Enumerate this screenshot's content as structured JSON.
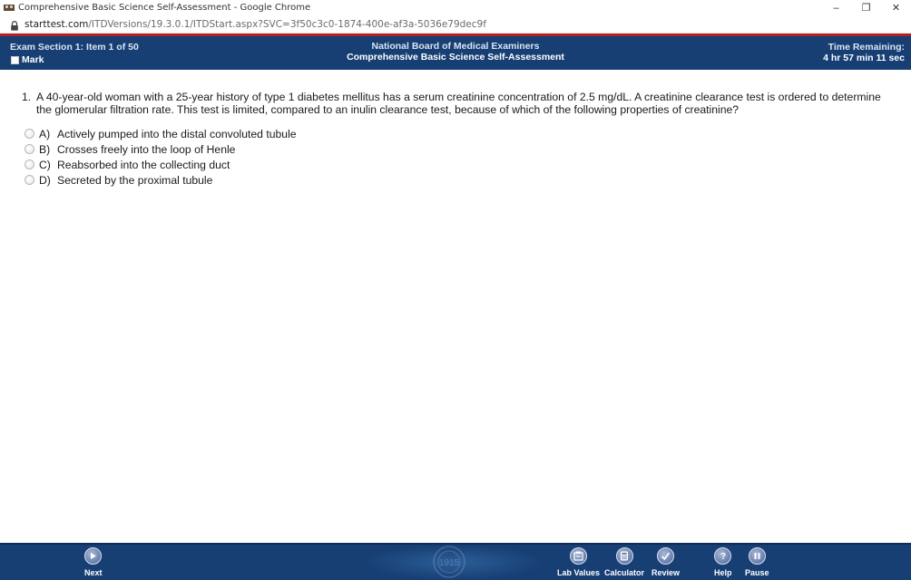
{
  "browser": {
    "window_title": "Comprehensive Basic Science Self-Assessment - Google Chrome",
    "url_host": "starttest.com",
    "url_path": "/ITDVersions/19.3.0.1/ITDStart.aspx?SVC=3f50c3c0-1874-400e-af3a-5036e79dec9f",
    "controls": {
      "minimize": "–",
      "restore": "❐",
      "close": "✕"
    }
  },
  "header": {
    "section_info": "Exam Section 1: Item 1 of 50",
    "mark_label": "Mark",
    "org": "National Board of Medical Examiners",
    "exam_title": "Comprehensive Basic Science Self-Assessment",
    "time_label": "Time Remaining:",
    "time_value": "4 hr 57 min 11 sec"
  },
  "question": {
    "number": "1.",
    "text": "A 40-year-old woman with a 25-year history of type 1 diabetes mellitus has a serum creatinine concentration of 2.5 mg/dL. A creatinine clearance test is ordered to determine the glomerular filtration rate. This test is limited, compared to an inulin clearance test, because of which of the following properties of creatinine?",
    "options": [
      {
        "letter": "A)",
        "text": "Actively pumped into the distal convoluted tubule"
      },
      {
        "letter": "B)",
        "text": "Crosses freely into the loop of Henle"
      },
      {
        "letter": "C)",
        "text": "Reabsorbed into the collecting duct"
      },
      {
        "letter": "D)",
        "text": "Secreted by the proximal tubule"
      }
    ]
  },
  "toolbar": {
    "next": "Next",
    "lab_values": "Lab Values",
    "calculator": "Calculator",
    "review": "Review",
    "help": "Help",
    "pause": "Pause",
    "seal_text": "1915"
  },
  "colors": {
    "header_bg": "#173f74",
    "accent_red": "#b22222"
  }
}
